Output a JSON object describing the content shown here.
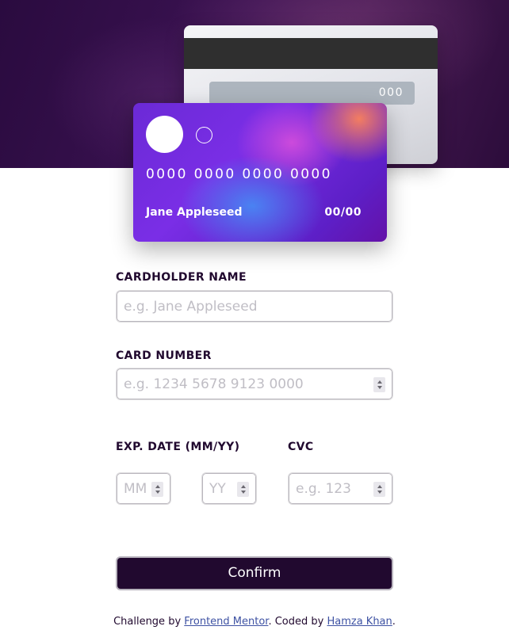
{
  "card_back": {
    "cvc": "000"
  },
  "card_front": {
    "number": "0000 0000 0000 0000",
    "name": "Jane Appleseed",
    "expiry": "00/00"
  },
  "form": {
    "name_label": "CARDHOLDER NAME",
    "name_placeholder": "e.g. Jane Appleseed",
    "number_label": "CARD NUMBER",
    "number_placeholder": "e.g. 1234 5678 9123 0000",
    "exp_label": "EXP. DATE (MM/YY)",
    "mm_placeholder": "MM",
    "yy_placeholder": "YY",
    "cvc_label": "CVC",
    "cvc_placeholder": "e.g. 123",
    "confirm_label": "Confirm"
  },
  "footer": {
    "prefix": "Challenge by ",
    "link1": "Frontend Mentor",
    "middle": ". Coded by ",
    "link2": "Hamza Khan",
    "suffix": "."
  },
  "colors": {
    "dark_violet": "#21092f",
    "placeholder_gray": "#c0bec5",
    "link_blue": "#3e52a3"
  }
}
